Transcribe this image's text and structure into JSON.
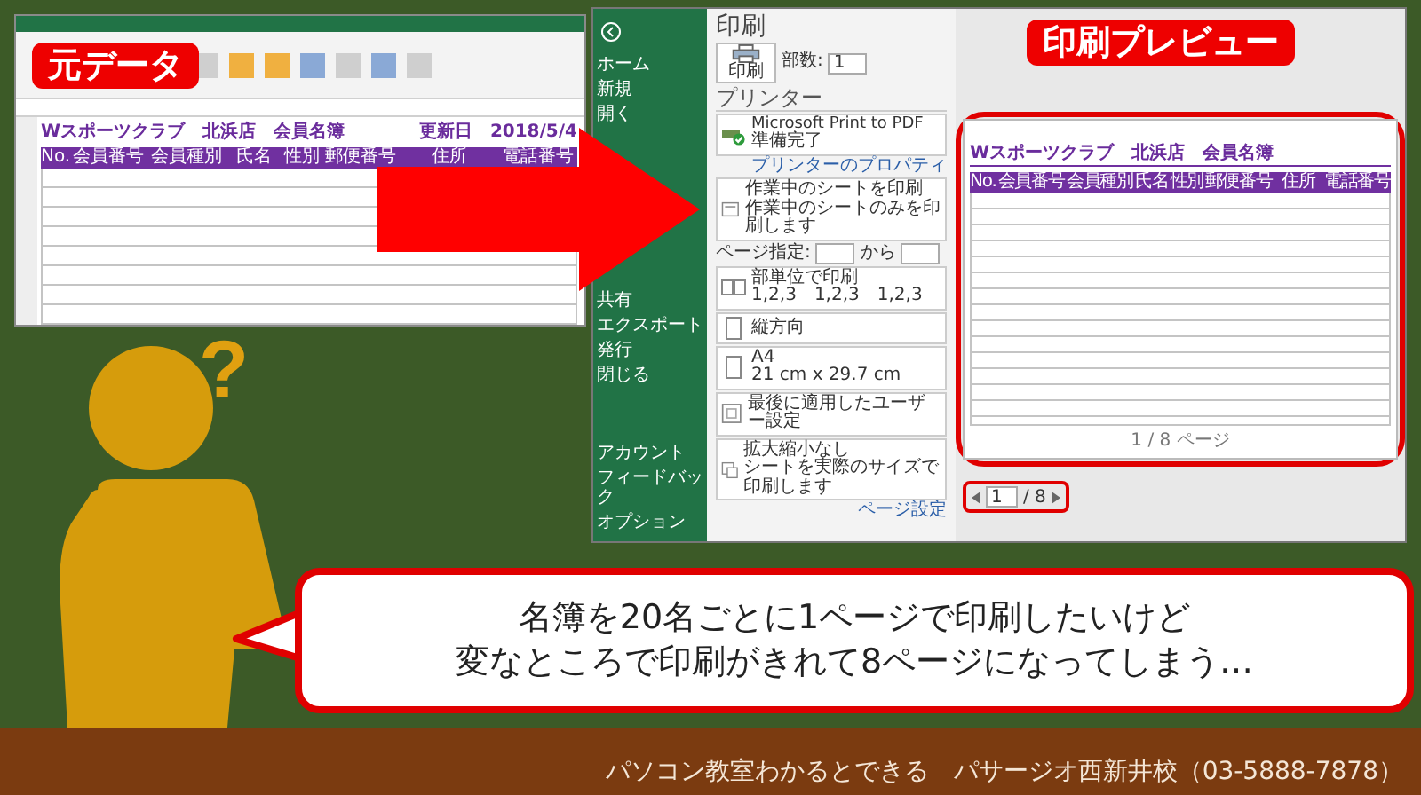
{
  "source_label": "元データ",
  "preview_label": "印刷プレビュー",
  "excel": {
    "sheet_title": "Wスポーツクラブ　北浜店　会員名簿",
    "updated_label": "更新日",
    "updated_date": "2018/5/4",
    "columns": [
      "No.",
      "会員番号",
      "会員種別",
      "氏名",
      "性別",
      "郵便番号",
      "住所",
      "電話番号"
    ]
  },
  "backstage": {
    "top_items": [
      "ホーム",
      "新規",
      "開く"
    ],
    "middle_items": [
      "共有",
      "エクスポート",
      "発行",
      "閉じる"
    ],
    "bottom_items": [
      "アカウント",
      "フィードバック",
      "オプション"
    ]
  },
  "print": {
    "title": "印刷",
    "print_button": "印刷",
    "copies_label": "部数:",
    "copies": "1",
    "printer_heading": "プリンター",
    "printer_name": "Microsoft Print to PDF",
    "printer_status": "準備完了",
    "printer_properties": "プリンターのプロパティ",
    "settings": [
      {
        "kind": "sheets",
        "line1": "作業中のシートを印刷",
        "line2": "作業中のシートのみを印刷します"
      },
      {
        "kind": "range",
        "line1": "ページ指定:",
        "line2": "から"
      },
      {
        "kind": "collate",
        "line1": "部単位で印刷",
        "line2": "1,2,3　1,2,3　1,2,3"
      },
      {
        "kind": "orientation",
        "line1": "縦方向"
      },
      {
        "kind": "paper",
        "line1": "A4",
        "line2": "21 cm x 29.7 cm"
      },
      {
        "kind": "margins",
        "line1": "最後に適用したユーザー設定"
      },
      {
        "kind": "scaling",
        "line1": "拡大縮小なし",
        "line2": "シートを実際のサイズで印刷します"
      }
    ],
    "page_setup": "ページ設定"
  },
  "preview": {
    "sheet_title": "Wスポーツクラブ　北浜店　会員名簿",
    "columns": [
      "No.",
      "会員番号",
      "会員種別",
      "氏名",
      "性別",
      "郵便番号",
      "住所",
      "電話番号"
    ],
    "page_footer": "1 / 8 ページ",
    "page_current": "1",
    "page_total": "/ 8"
  },
  "question_mark": "?",
  "bubble_lines": [
    "名簿を20名ごとに1ページで印刷したいけど",
    "変なところで印刷がきれて8ページになってしまう…"
  ],
  "footer": "パソコン教室わかるとできる　パサージオ西新井校（03-5888-7878）"
}
